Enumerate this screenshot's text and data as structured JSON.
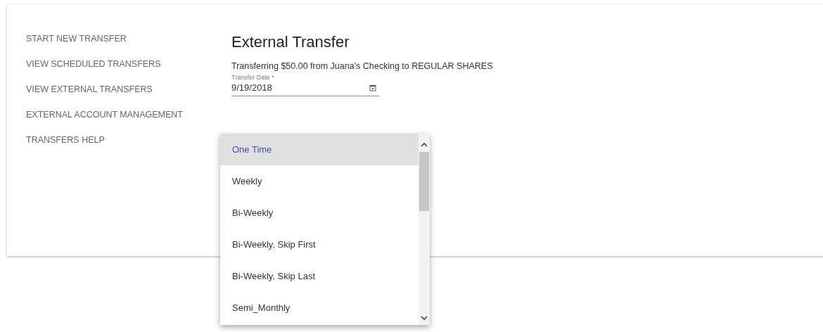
{
  "sidebar": {
    "items": [
      {
        "label": "START NEW TRANSFER",
        "selected": false
      },
      {
        "label": "VIEW SCHEDULED TRANSFERS",
        "selected": false
      },
      {
        "label": "VIEW EXTERNAL TRANSFERS",
        "selected": false
      },
      {
        "label": "EXTERNAL ACCOUNT MANAGEMENT",
        "selected": false
      },
      {
        "label": "TRANSFERS HELP",
        "selected": false
      }
    ]
  },
  "title": "External Transfer",
  "summary": "Transferring $50.00 from Juana's Checking to REGULAR SHARES",
  "transfer_date": {
    "label": "Transfer Date *",
    "value": "9/19/2018"
  },
  "frequency_menu": {
    "options": [
      {
        "label": "One Time",
        "selected": true
      },
      {
        "label": "Weekly",
        "selected": false
      },
      {
        "label": "Bi-Weekly",
        "selected": false
      },
      {
        "label": "Bi-Weekly, Skip First",
        "selected": false
      },
      {
        "label": "Bi-Weekly, Skip Last",
        "selected": false
      },
      {
        "label": "Semi_Monthly",
        "selected": false
      }
    ]
  }
}
